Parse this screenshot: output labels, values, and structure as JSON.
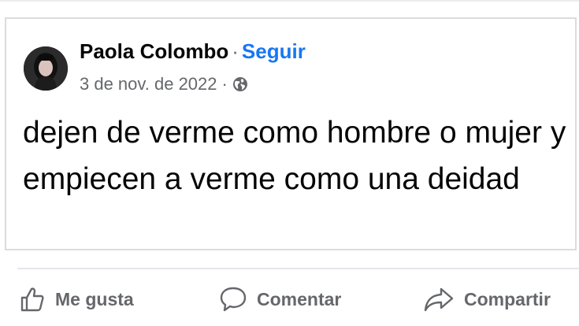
{
  "post": {
    "author": "Paola Colombo",
    "separator": "·",
    "follow_label": "Seguir",
    "date": "3 de nov. de 2022",
    "privacy_icon": "globe-icon",
    "text": "dejen de verme como hombre o mujer y empiecen a verme como una deidad"
  },
  "actions": {
    "like": {
      "label": "Me gusta",
      "icon": "thumbs-up-icon"
    },
    "comment": {
      "label": "Comentar",
      "icon": "comment-icon"
    },
    "share": {
      "label": "Compartir",
      "icon": "share-icon"
    }
  },
  "colors": {
    "link": "#1877f2",
    "secondary_text": "#65676b",
    "primary_text": "#050505"
  }
}
